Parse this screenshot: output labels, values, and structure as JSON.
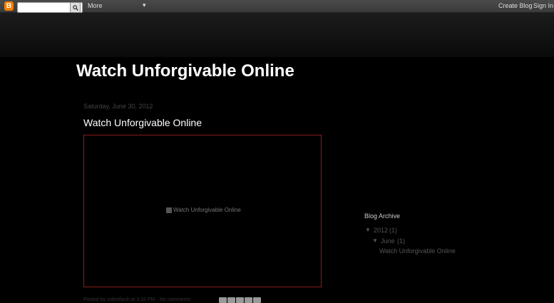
{
  "navbar": {
    "more_label": "More",
    "create_blog": "Create Blog",
    "sign_in": "Sign In",
    "search_placeholder": ""
  },
  "blog": {
    "title": "Watch Unforgivable Online"
  },
  "post": {
    "date": "Saturday, June 30, 2012",
    "title": "Watch Unforgivable Online",
    "image_alt": "Watch Unforgivable Online",
    "footer": "Posted by videoflash at 3:16 PM · No comments:"
  },
  "sidebar": {
    "archive_title": "Blog Archive",
    "year": "2012",
    "year_count": "(1)",
    "month": "June",
    "month_count": "(1)",
    "post_link": "Watch Unforgivable Online"
  },
  "colors": {
    "background": "#000000",
    "frame_border": "#8a1c1c",
    "navbar": "#444444"
  }
}
